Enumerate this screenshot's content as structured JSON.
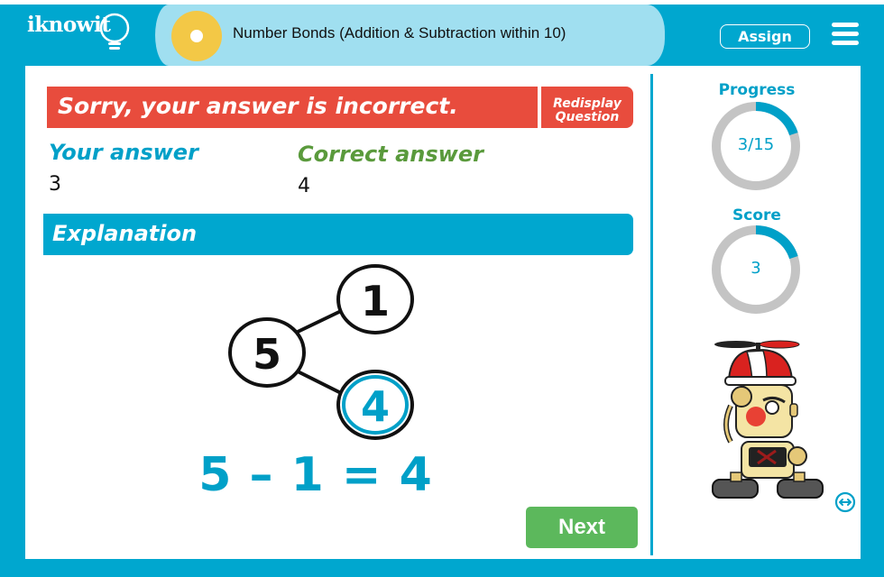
{
  "header": {
    "logo_text": "iknowit",
    "lesson_title": "Number Bonds (Addition & Subtraction within 10)",
    "assign_label": "Assign",
    "menu_icon": "hamburger-menu-icon",
    "badge_icon": "lesson-badge-icon"
  },
  "feedback": {
    "banner_text": "Sorry, your answer is incorrect.",
    "redisplay_line1": "Redisplay",
    "redisplay_line2": "Question",
    "your_answer_label": "Your answer",
    "your_answer_value": "3",
    "correct_answer_label": "Correct answer",
    "correct_answer_value": "4"
  },
  "explanation": {
    "heading": "Explanation",
    "bond": {
      "whole": "5",
      "part_top": "1",
      "part_bottom": "4"
    },
    "equation": "5 – 1 = 4"
  },
  "actions": {
    "next_label": "Next"
  },
  "sidebar": {
    "progress": {
      "label": "Progress",
      "text": "3/15",
      "current": 3,
      "total": 15
    },
    "score": {
      "label": "Score",
      "text": "3",
      "fraction": 0.2
    },
    "mascot": "robot-mascot",
    "expand_icon": "resize-arrows-icon"
  },
  "colors": {
    "brand_blue": "#00a7cf",
    "header_light_blue": "#a0dff0",
    "badge_yellow": "#f3c846",
    "incorrect_red": "#e84c3d",
    "correct_green": "#5a9a3c",
    "next_green": "#5cb85c",
    "ring_gray": "#c4c4c4"
  }
}
